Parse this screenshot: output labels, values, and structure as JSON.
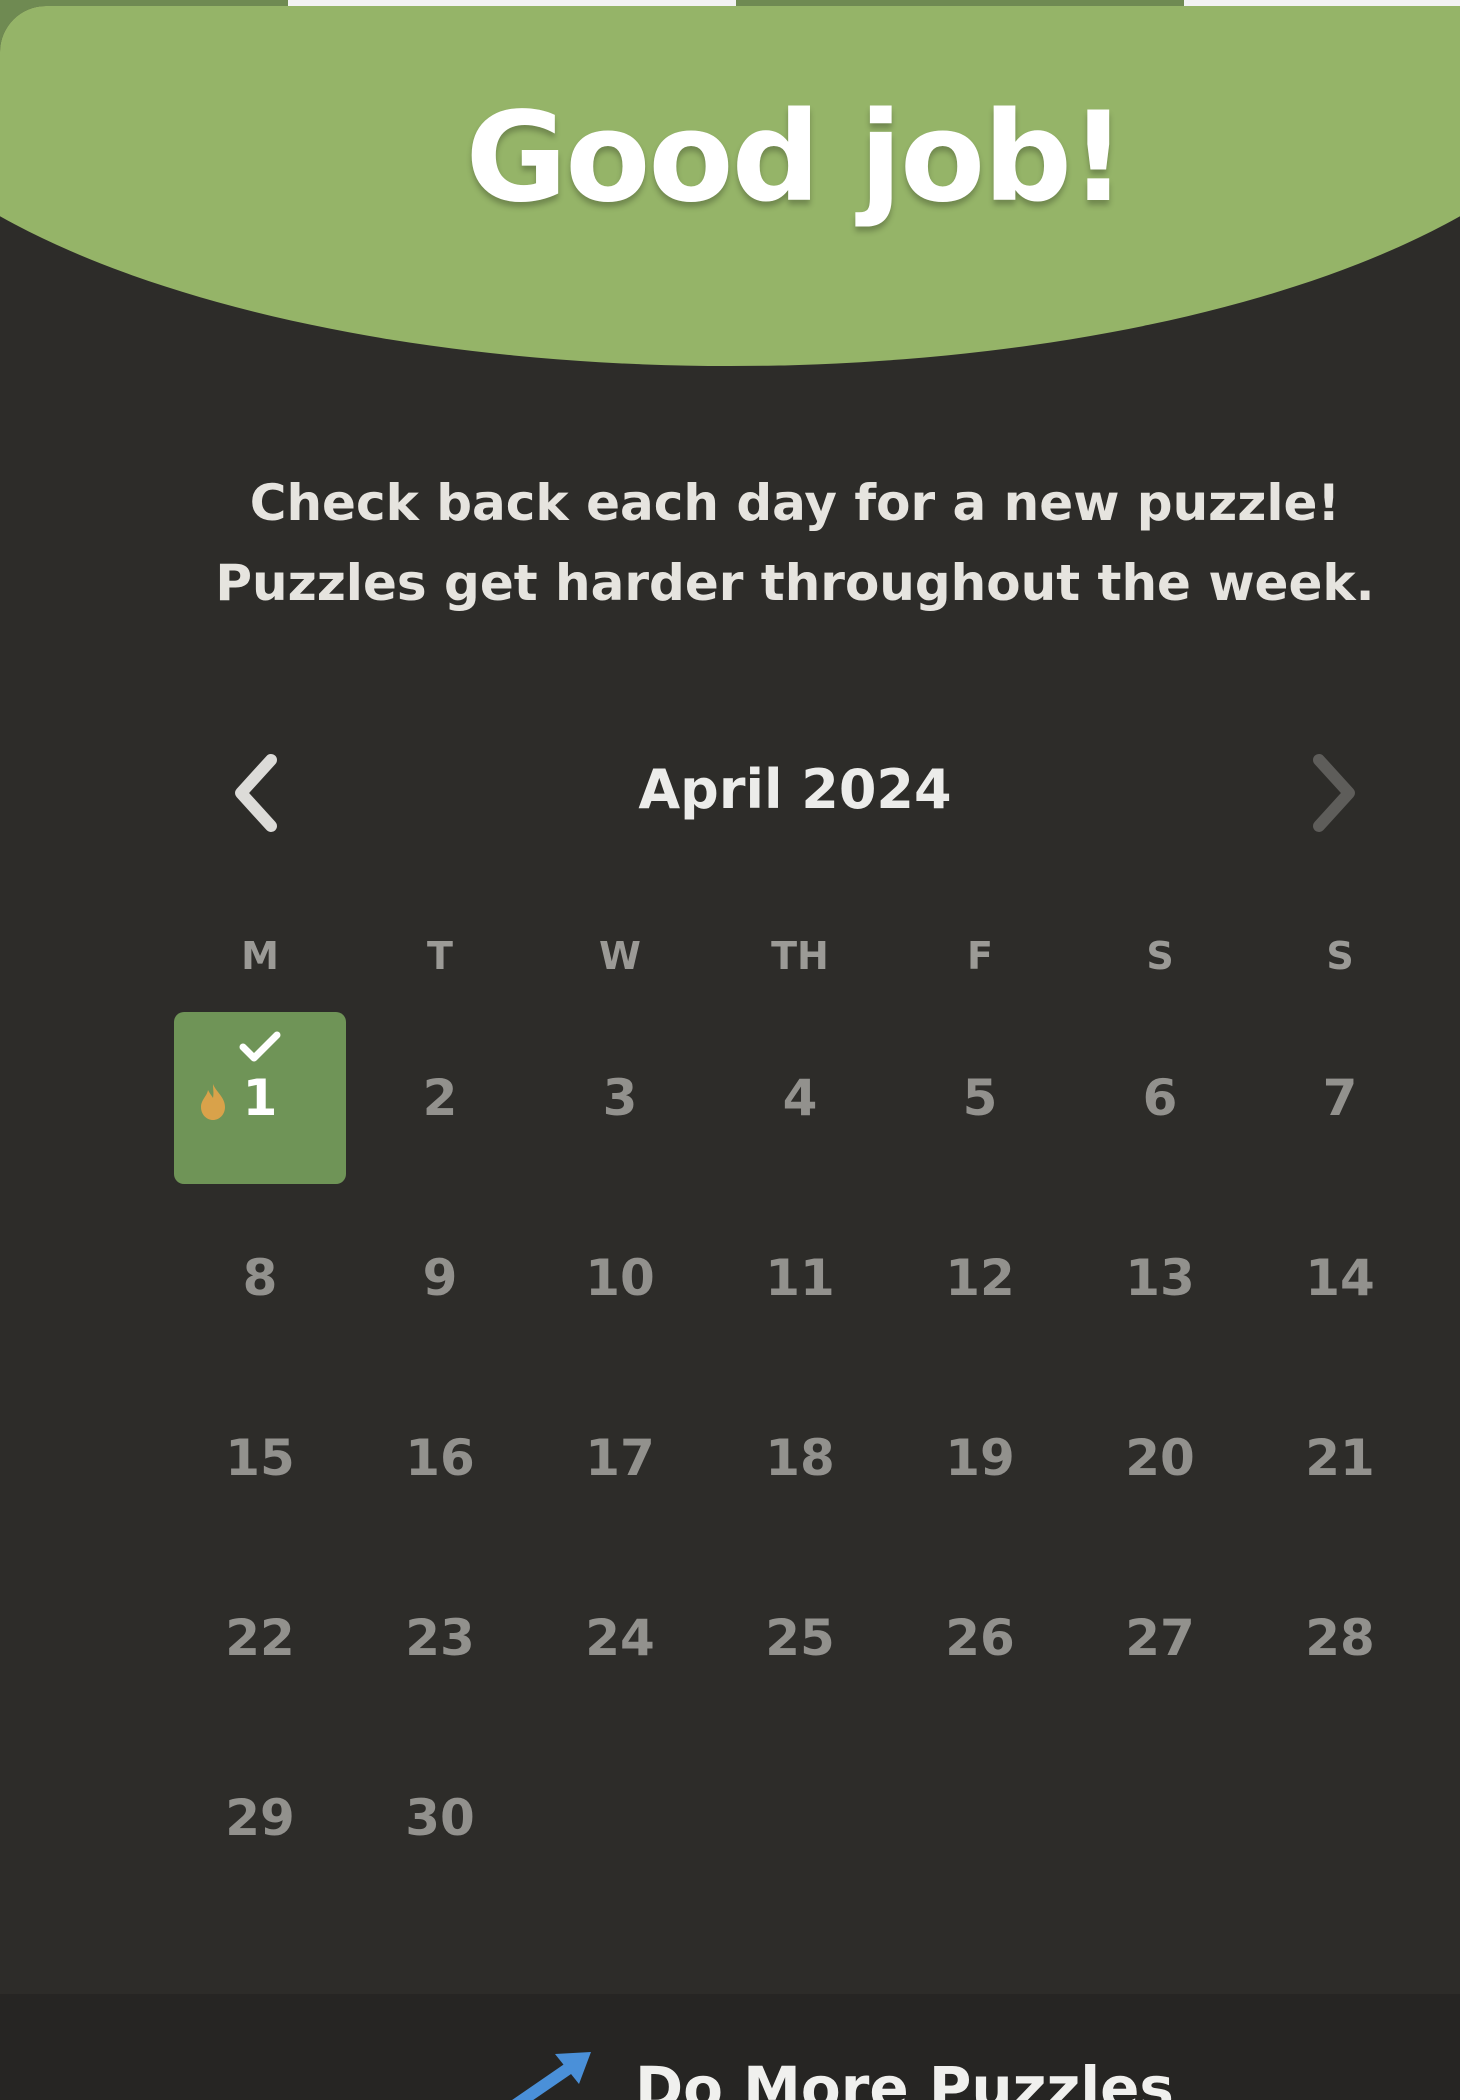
{
  "modal": {
    "title": "Good job!",
    "message_line1": "Check back each day for a new puzzle!",
    "message_line2": "Puzzles get harder throughout the week."
  },
  "calendar": {
    "month_label": "April 2024",
    "prev_icon": "chevron-left-icon",
    "next_icon": "chevron-right-icon",
    "weekdays": [
      "M",
      "T",
      "W",
      "TH",
      "F",
      "S",
      "S"
    ],
    "completed_day": 1,
    "days": [
      "1",
      "2",
      "3",
      "4",
      "5",
      "6",
      "7",
      "8",
      "9",
      "10",
      "11",
      "12",
      "13",
      "14",
      "15",
      "16",
      "17",
      "18",
      "19",
      "20",
      "21",
      "22",
      "23",
      "24",
      "25",
      "26",
      "27",
      "28",
      "29",
      "30"
    ]
  },
  "footer": {
    "more_link_label": "Do More Puzzles",
    "more_link_icon": "arrow-icon"
  },
  "colors": {
    "banner": "#95b468",
    "modal_bg": "#2d2c29",
    "completed_day": "#6f9457",
    "streak_flame": "#d9a24a"
  }
}
